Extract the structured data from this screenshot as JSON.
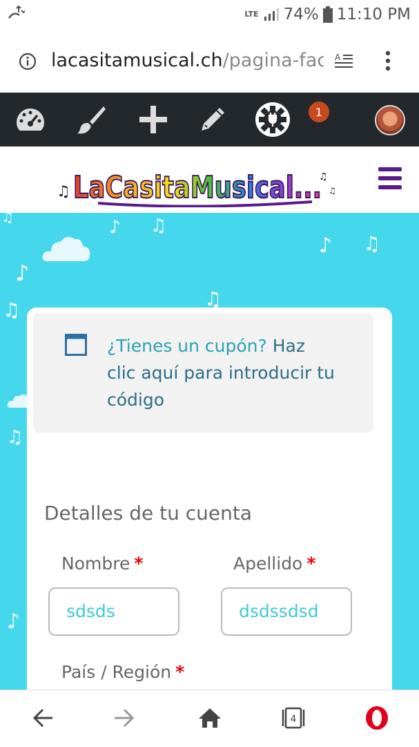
{
  "status_bar": {
    "network": "LTE",
    "battery": "74%",
    "time": "11:10 PM"
  },
  "browser": {
    "url_host": "lacasitamusical.ch",
    "url_path": "/pagina-factur"
  },
  "admin_bar": {
    "notification_count": "1"
  },
  "site": {
    "logo_text": "LaCasitaMusical..."
  },
  "coupon": {
    "question": "¿Tienes un cupón?",
    "link": " Haz clic aquí para introducir tu código"
  },
  "account": {
    "title": "Detalles de tu cuenta",
    "first_name_label": "Nombre",
    "last_name_label": "Apellido",
    "first_name_value": "sdsds",
    "last_name_value": "dsdssdsd",
    "country_label": "País / Región",
    "required_mark": "*"
  },
  "bottom_nav": {
    "tabs_count": "4"
  },
  "colors": {
    "admin_bar": "#23282d",
    "page_bg": "#45d7ec",
    "badge": "#ca4a1f",
    "menu_purple": "#5a1a8c",
    "link": "#2aa3b7"
  }
}
